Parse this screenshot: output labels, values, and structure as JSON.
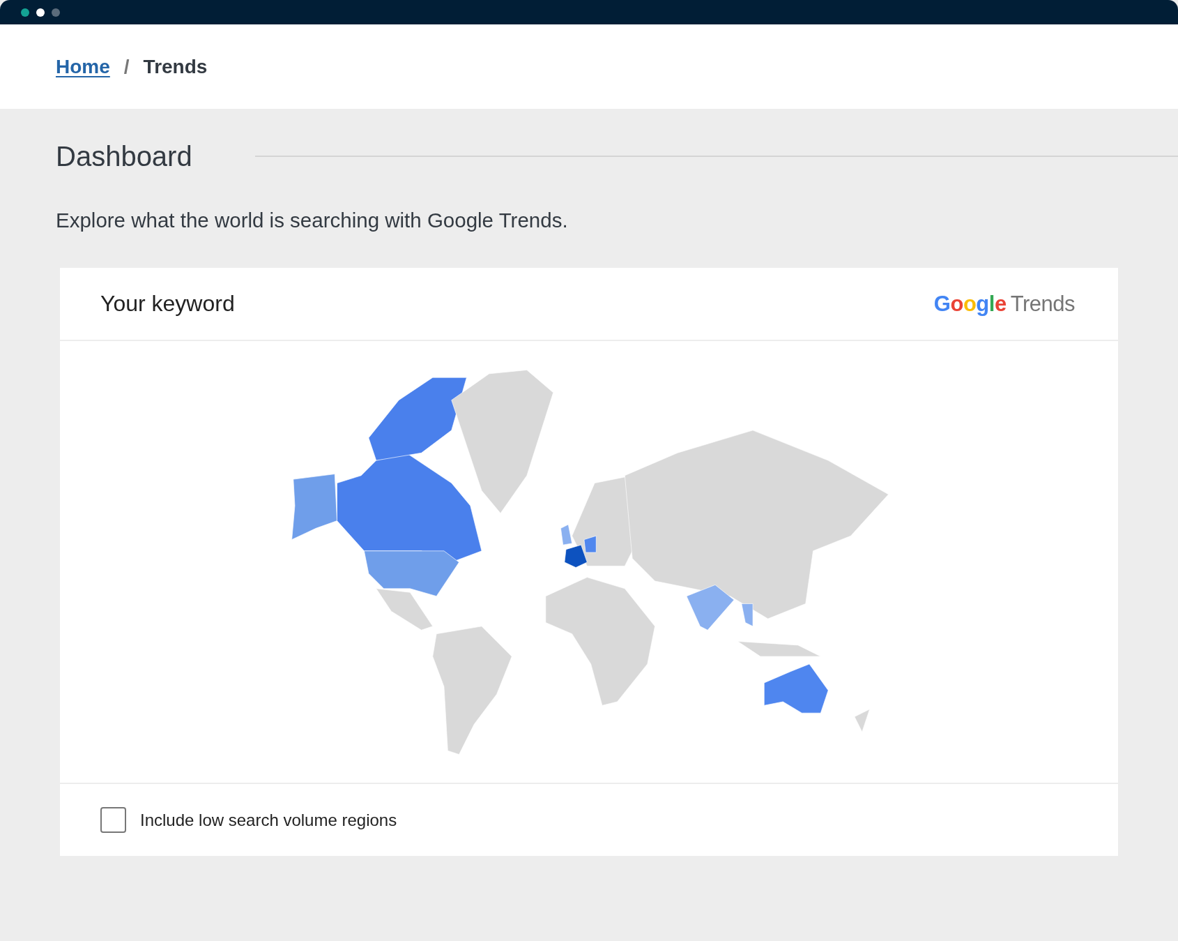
{
  "breadcrumb": [
    {
      "label": "Home",
      "link": true
    },
    {
      "label": "Trends",
      "link": false
    }
  ],
  "breadcrumb_separator": "/",
  "page": {
    "title": "Dashboard",
    "description": "Explore what the world is searching with Google Trends."
  },
  "card": {
    "title": "Your keyword",
    "logo": {
      "brand": "Google",
      "product": "Trends"
    },
    "option": {
      "label": "Include low search volume regions",
      "checked": false
    }
  }
}
